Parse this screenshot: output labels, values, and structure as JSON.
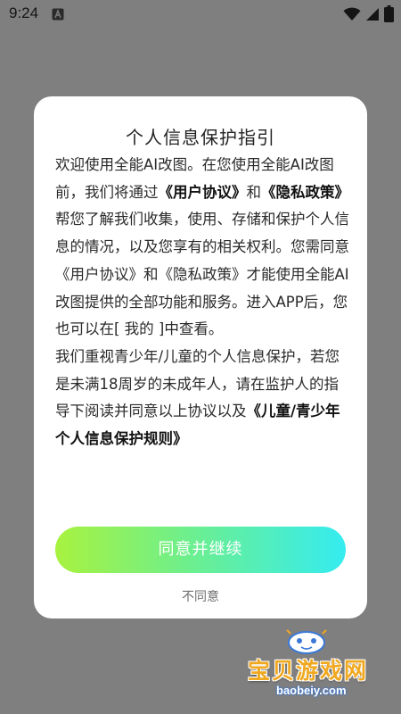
{
  "status_bar": {
    "time": "9:24",
    "icons": [
      "app-notification-icon",
      "wifi-icon",
      "cellular-signal-icon",
      "battery-icon"
    ]
  },
  "dialog": {
    "title": "个人信息保护指引",
    "body": {
      "p1_t1": "欢迎使用全能AI改图。在您使用全能AI改图前，我们将通过",
      "link_user_agreement": "《用户协议》",
      "p1_t2": "和",
      "link_privacy_policy": "《隐私政策》",
      "p1_t3": "帮您了解我们收集，使用、存储和保护个人信息的情况，以及您享有的相关权利。您需同意《用户协议》和《隐私政策》才能使用全能AI改图提供的全部功能和服务。进入APP后，您也可以在[ 我的 ]中查看。",
      "p2_t1": "我们重视青少年/儿童的个人信息保护，若您是未满18周岁的未成年人，请在监护人的指导下阅读并同意以上协议以及",
      "link_minor_rules": "《儿童/青少年个人信息保护规则》"
    },
    "agree_label": "同意并继续",
    "disagree_label": "不同意"
  },
  "watermark": {
    "cn_text": "宝贝游戏网",
    "en_text": "baobeiy.com"
  },
  "colors": {
    "overlay": "#7f7f7f",
    "dialog_bg": "#ffffff",
    "button_gradient_start": "#a8f23f",
    "button_gradient_end": "#35ecf0",
    "watermark_cn": "#f0a820"
  }
}
